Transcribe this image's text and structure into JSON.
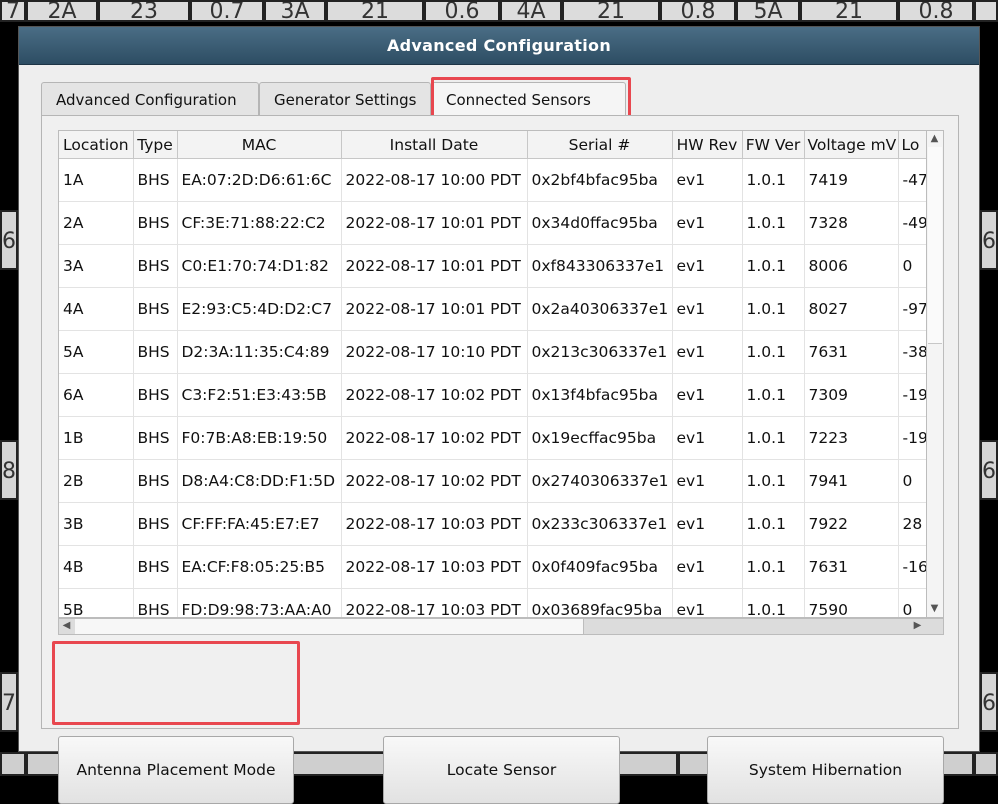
{
  "background": {
    "top_cells": [
      "7",
      "2A",
      "23",
      "0.7",
      "3A",
      "21",
      "0.6",
      "4A",
      "21",
      "0.8",
      "5A",
      "21",
      "0.8"
    ],
    "left_cells": [
      "6",
      "8",
      "7"
    ],
    "right_cells": [
      "6",
      "6",
      "6"
    ]
  },
  "dialog": {
    "title": "Advanced Configuration",
    "tabs": [
      "Advanced Configuration",
      "Generator Settings",
      "Connected Sensors"
    ],
    "active_tab": "Connected Sensors"
  },
  "table": {
    "columns": [
      "Location",
      "Type",
      "MAC",
      "Install Date",
      "Serial #",
      "HW Rev",
      "FW Ver",
      "Voltage mV",
      "Lo"
    ],
    "rows": [
      [
        "1A",
        "BHS",
        "EA:07:2D:D6:61:6C",
        "2022-08-17 10:00 PDT",
        "0x2bf4bfac95ba",
        "ev1",
        "1.0.1",
        "7419",
        "-47"
      ],
      [
        "2A",
        "BHS",
        "CF:3E:71:88:22:C2",
        "2022-08-17 10:01 PDT",
        "0x34d0ffac95ba",
        "ev1",
        "1.0.1",
        "7328",
        "-49"
      ],
      [
        "3A",
        "BHS",
        "C0:E1:70:74:D1:82",
        "2022-08-17 10:01 PDT",
        "0xf843306337e1",
        "ev1",
        "1.0.1",
        "8006",
        "0"
      ],
      [
        "4A",
        "BHS",
        "E2:93:C5:4D:D2:C7",
        "2022-08-17 10:01 PDT",
        "0x2a40306337e1",
        "ev1",
        "1.0.1",
        "8027",
        "-97"
      ],
      [
        "5A",
        "BHS",
        "D2:3A:11:35:C4:89",
        "2022-08-17 10:10 PDT",
        "0x213c306337e1",
        "ev1",
        "1.0.1",
        "7631",
        "-38"
      ],
      [
        "6A",
        "BHS",
        "C3:F2:51:E3:43:5B",
        "2022-08-17 10:02 PDT",
        "0x13f4bfac95ba",
        "ev1",
        "1.0.1",
        "7309",
        "-19"
      ],
      [
        "1B",
        "BHS",
        "F0:7B:A8:EB:19:50",
        "2022-08-17 10:02 PDT",
        "0x19ecffac95ba",
        "ev1",
        "1.0.1",
        "7223",
        "-19"
      ],
      [
        "2B",
        "BHS",
        "D8:A4:C8:DD:F1:5D",
        "2022-08-17 10:02 PDT",
        "0x2740306337e1",
        "ev1",
        "1.0.1",
        "7941",
        "0"
      ],
      [
        "3B",
        "BHS",
        "CF:FF:FA:45:E7:E7",
        "2022-08-17 10:03 PDT",
        "0x233c306337e1",
        "ev1",
        "1.0.1",
        "7922",
        "28"
      ],
      [
        "4B",
        "BHS",
        "EA:CF:F8:05:25:B5",
        "2022-08-17 10:03 PDT",
        "0x0f409fac95ba",
        "ev1",
        "1.0.1",
        "7631",
        "-16"
      ],
      [
        "5B",
        "BHS",
        "FD:D9:98:73:AA:A0",
        "2022-08-17 10:03 PDT",
        "0x03689fac95ba",
        "ev1",
        "1.0.1",
        "7590",
        "0"
      ]
    ]
  },
  "buttons": {
    "antenna": "Antenna Placement Mode",
    "locate": "Locate Sensor",
    "hibernate": "System Hibernation"
  },
  "icons": {
    "scroll_up": "▲",
    "scroll_down": "▼",
    "scroll_left": "◀",
    "scroll_right": "▶"
  },
  "colors": {
    "title_bar": "#2d4d63",
    "highlight": "#e8474f"
  }
}
